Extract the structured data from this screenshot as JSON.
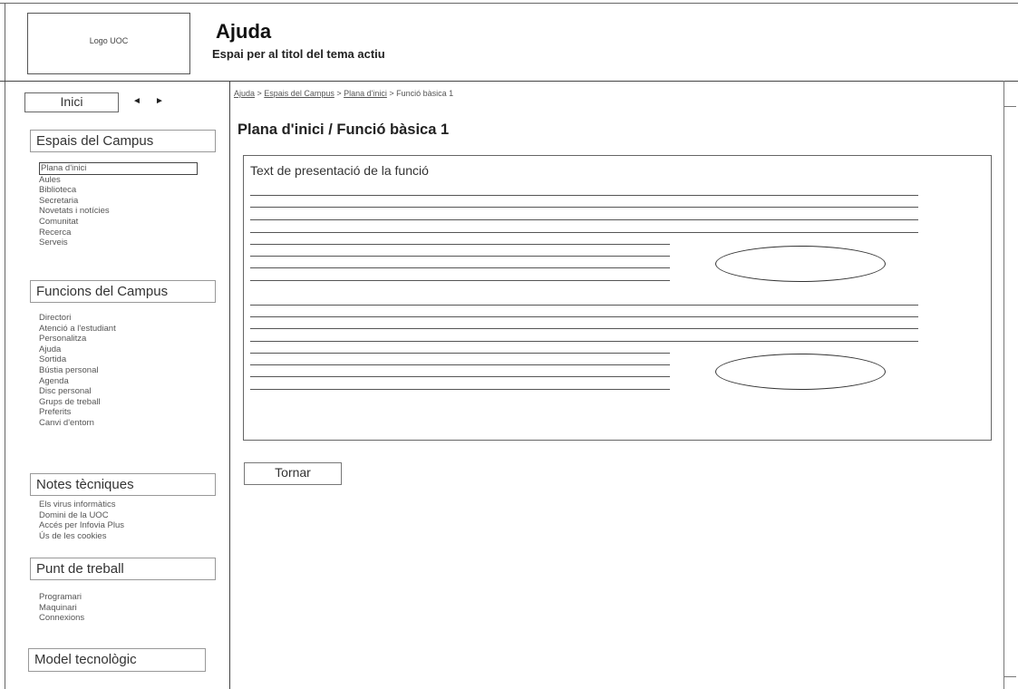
{
  "header": {
    "logo_text": "Logo UOC",
    "title": "Ajuda",
    "subtitle": "Espai per al titol del tema actiu"
  },
  "sidebar": {
    "home_label": "Inici",
    "arrow_left": "◄",
    "arrow_right": "►",
    "sections": [
      {
        "title": "Espais del Campus",
        "items": [
          "Plana d'inici",
          "Aules",
          "Biblioteca",
          "Secretaria",
          "Novetats i notícies",
          "Comunitat",
          "Recerca",
          "Serveis"
        ],
        "selected_index": 0
      },
      {
        "title": "Funcions  del Campus",
        "items": [
          "Directori",
          "Atenció a l'estudiant",
          "Personalitza",
          "Ajuda",
          "Sortida",
          "Bústia personal",
          "Agenda",
          "Disc personal",
          "Grups de treball",
          "Preferits",
          "Canvi d'entorn"
        ]
      },
      {
        "title": "Notes tècniques",
        "items": [
          "Els virus informàtics",
          "Domini de la UOC",
          "Accés per Infovia Plus",
          "Ús de les cookies"
        ]
      },
      {
        "title": "Punt de treball",
        "items": [
          "Programari",
          "Maquinari",
          "Connexions"
        ]
      },
      {
        "title": "Model tecnològic",
        "items": []
      }
    ]
  },
  "breadcrumb": {
    "items": [
      "Ajuda",
      "Espais del Campus",
      "Plana d'inici"
    ],
    "separator": " > ",
    "current": "Funció bàsica 1"
  },
  "main": {
    "page_title": "Plana d'inici / Funció bàsica 1",
    "intro_text": "Text de presentació de la funció",
    "back_button": "Tornar"
  }
}
